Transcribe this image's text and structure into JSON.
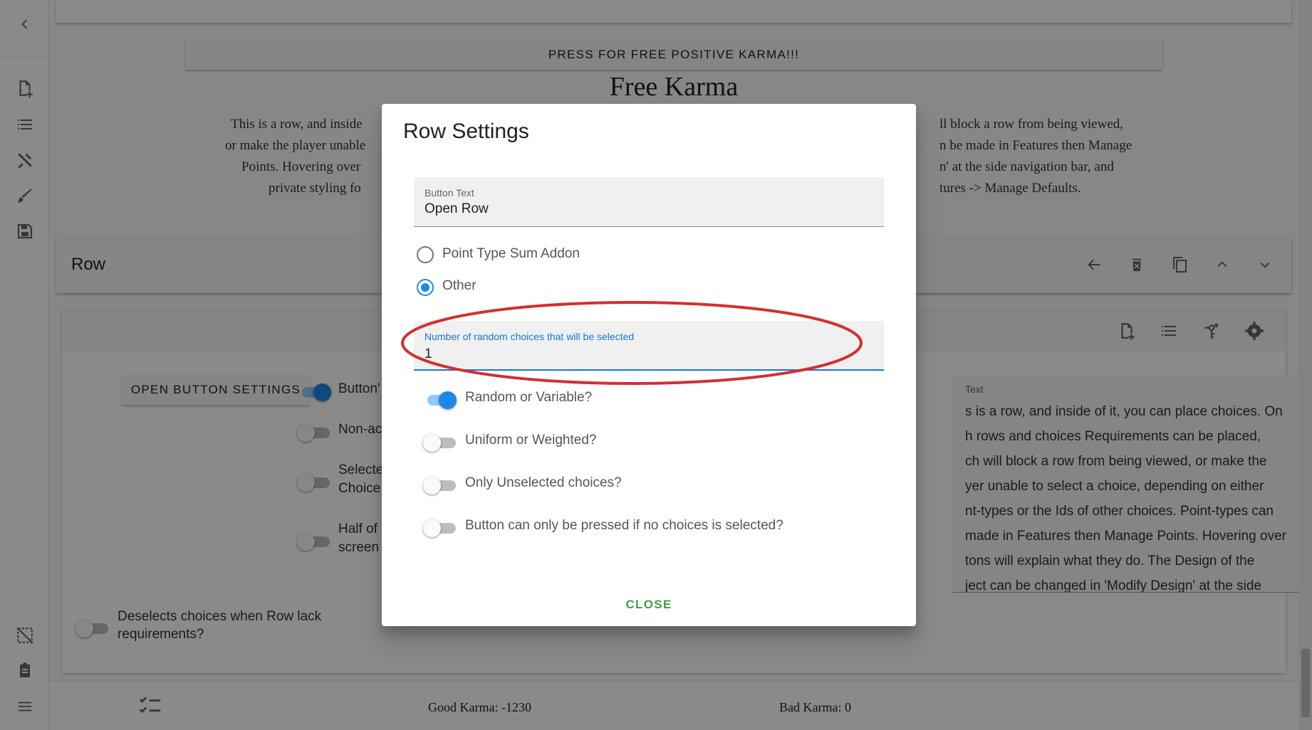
{
  "sidebar": {
    "icons": [
      "chevron-left-icon",
      "new-file-icon",
      "list-icon",
      "tools-icon",
      "brush-icon",
      "save-icon",
      "grid-off-icon",
      "clipboard-icon",
      "menu-icon"
    ]
  },
  "main": {
    "karma_button": "PRESS FOR FREE POSITIVE KARMA!!!",
    "row_title": "Free Karma",
    "row_desc_visible": {
      "left": [
        "This is a row, and inside",
        "or make the player unable",
        "Points. Hovering over",
        "private styling fo"
      ],
      "right": [
        "ll block a row from being viewed,",
        "n be made in Features then Manage",
        "n' at the side navigation bar, and",
        "tures -> Manage Defaults."
      ]
    },
    "row_bar_label": "Row",
    "open_button_settings": "OPEN BUTTON SETTINGS",
    "toggles": [
      {
        "label": "Button'",
        "on": true
      },
      {
        "label": "Non-ac",
        "on": false
      },
      {
        "label_line1": "Selecte",
        "label_line2": "Choice",
        "on": false
      },
      {
        "label_line1": "Half of",
        "label_line2": "screen",
        "on": false
      }
    ],
    "deselect_toggle": {
      "label_line1": "Deselects choices when Row lack",
      "label_line2": "requirements?",
      "on": false
    },
    "text_field": {
      "label": "Text",
      "lines": [
        "s is a row, and inside of it, you can place choices. On",
        "h rows and choices Requirements can be placed,",
        "ch will block a row from being viewed, or make the",
        "yer unable to select a choice, depending on either",
        "nt-types or the Ids of other choices. Point-types can",
        "made in Features then Manage Points. Hovering over",
        "tons will explain what they do. The Design of the",
        "ject can be changed in 'Modify Design' at the side"
      ]
    }
  },
  "bottom_bar": {
    "good_karma": "Good Karma: -1230",
    "bad_karma": "Bad Karma: 0"
  },
  "dialog": {
    "title": "Row Settings",
    "button_text_label": "Button Text",
    "button_text_value": "Open Row",
    "radio_options": [
      {
        "label": "Point Type Sum Addon",
        "selected": false
      },
      {
        "label": "Other",
        "selected": true
      }
    ],
    "random_choices_label": "Number of random choices that will be selected",
    "random_choices_value": "1",
    "toggles": [
      {
        "label": "Random or Variable?",
        "on": true
      },
      {
        "label": "Uniform or Weighted?",
        "on": false
      },
      {
        "label": "Only Unselected choices?",
        "on": false
      },
      {
        "label": "Button can only be pressed if no choices is selected?",
        "on": false
      }
    ],
    "close_label": "CLOSE"
  },
  "colors": {
    "accent_blue": "#1e88e5",
    "close_green": "#43a047",
    "annotation_red": "#d32f2f"
  }
}
